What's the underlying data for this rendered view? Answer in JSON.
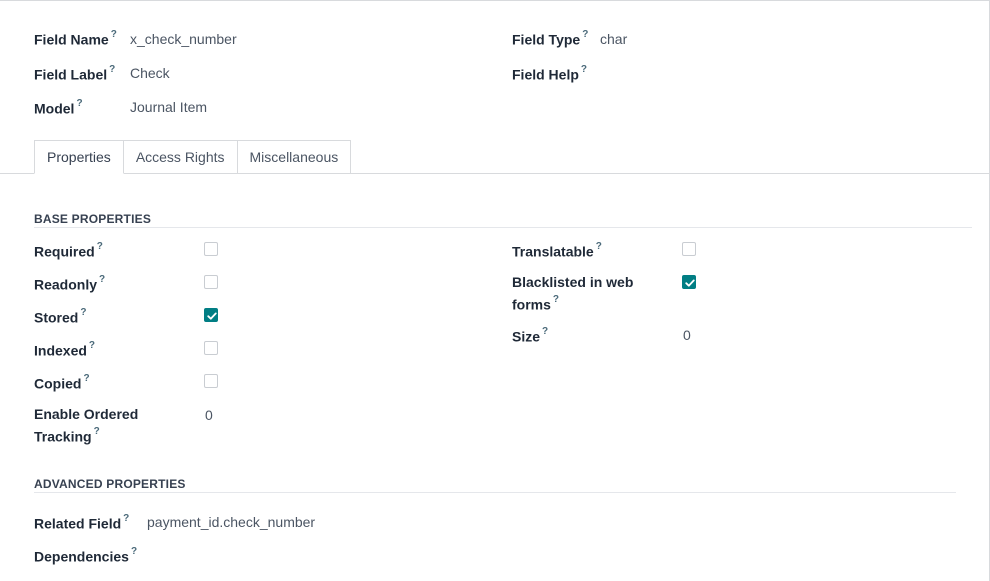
{
  "header": {
    "field_name": {
      "label": "Field Name",
      "help": "?",
      "value": "x_check_number"
    },
    "field_label": {
      "label": "Field Label",
      "help": "?",
      "value": "Check"
    },
    "model": {
      "label": "Model",
      "help": "?",
      "value": "Journal Item"
    },
    "field_type": {
      "label": "Field Type",
      "help": "?",
      "value": "char"
    },
    "field_help": {
      "label": "Field Help",
      "help": "?",
      "value": ""
    }
  },
  "tabs": [
    {
      "label": "Properties",
      "active": true
    },
    {
      "label": "Access Rights",
      "active": false
    },
    {
      "label": "Miscellaneous",
      "active": false
    }
  ],
  "base": {
    "title": "BASE PROPERTIES",
    "required": {
      "label": "Required",
      "help": "?",
      "checked": false
    },
    "readonly": {
      "label": "Readonly",
      "help": "?",
      "checked": false
    },
    "stored": {
      "label": "Stored",
      "help": "?",
      "checked": true
    },
    "indexed": {
      "label": "Indexed",
      "help": "?",
      "checked": false
    },
    "copied": {
      "label": "Copied",
      "help": "?",
      "checked": false
    },
    "tracking": {
      "label_line1": "Enable Ordered",
      "label_line2": "Tracking",
      "help": "?",
      "value": "0"
    },
    "translatable": {
      "label": "Translatable",
      "help": "?",
      "checked": false
    },
    "blacklisted": {
      "label_line1": "Blacklisted in web",
      "label_line2": "forms",
      "help": "?",
      "checked": true
    },
    "size": {
      "label": "Size",
      "help": "?",
      "value": "0"
    }
  },
  "advanced": {
    "title": "ADVANCED PROPERTIES",
    "related_field": {
      "label": "Related Field",
      "help": "?",
      "value": "payment_id.check_number"
    },
    "dependencies": {
      "label": "Dependencies",
      "help": "?",
      "value": ""
    }
  },
  "colors": {
    "accent": "#017e84",
    "border": "#d8dadd"
  }
}
